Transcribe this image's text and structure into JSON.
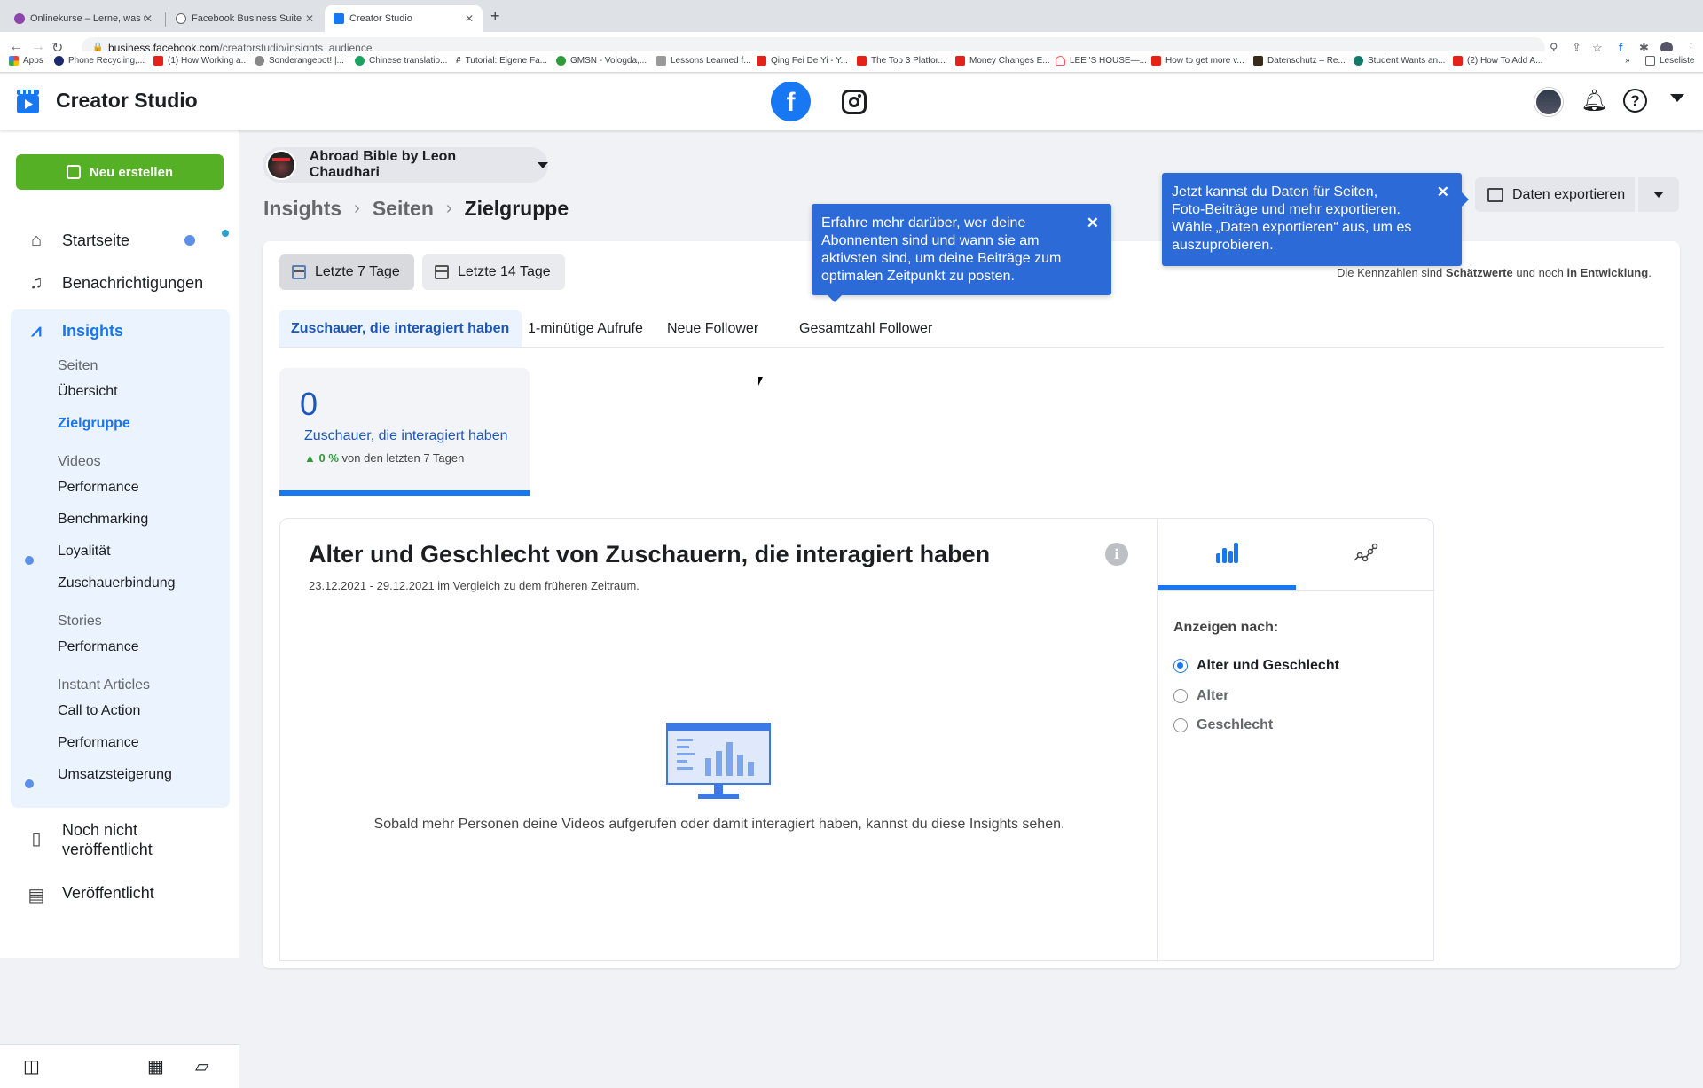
{
  "browser": {
    "tabs": [
      {
        "title": "Onlinekurse – Lerne, was und v",
        "favicon_color": "#8e44ad",
        "active": false
      },
      {
        "title": "Facebook Business Suite",
        "favicon_color": "#5f6368",
        "active": false
      },
      {
        "title": "Creator Studio",
        "favicon_color": "#1877f2",
        "active": true
      }
    ],
    "url_host": "business.facebook.com",
    "url_path": "/creatorstudio/insights_audience",
    "bookmarks": [
      {
        "label": "Apps",
        "color": "#ea4335"
      },
      {
        "label": "Phone Recycling,...",
        "color": "#1a2a6c"
      },
      {
        "label": "(1) How Working a...",
        "color": "#e62117"
      },
      {
        "label": "Sonderangebot! |...",
        "color": "#888888"
      },
      {
        "label": "Chinese translatio...",
        "color": "#1aa260"
      },
      {
        "label": "Tutorial: Eigene Fa...",
        "color": "#333333"
      },
      {
        "label": "GMSN - Vologda,...",
        "color": "#2e9b3a"
      },
      {
        "label": "Lessons Learned f...",
        "color": "#666666"
      },
      {
        "label": "Qing Fei De Yi - Y...",
        "color": "#e62117"
      },
      {
        "label": "The Top 3 Platfor...",
        "color": "#e62117"
      },
      {
        "label": "Money Changes E...",
        "color": "#e62117"
      },
      {
        "label": "LEE 'S HOUSE—...",
        "color": "#ff5a5f"
      },
      {
        "label": "How to get more v...",
        "color": "#e62117"
      },
      {
        "label": "Datenschutz – Re...",
        "color": "#3a2a1a"
      },
      {
        "label": "Student Wants an...",
        "color": "#137a6b"
      },
      {
        "label": "(2) How To Add A...",
        "color": "#e62117"
      }
    ],
    "reading_list": "Leseliste"
  },
  "app": {
    "title": "Creator Studio",
    "platforms": [
      "facebook",
      "instagram"
    ]
  },
  "sidebar": {
    "create_button": "Neu erstellen",
    "items": [
      {
        "label": "Startseite",
        "icon": "home-icon"
      },
      {
        "label": "Benachrichtigungen",
        "icon": "bell-icon"
      },
      {
        "label": "Insights",
        "icon": "insights-icon",
        "active": true
      }
    ],
    "insights_sections": [
      {
        "heading": "Seiten",
        "items": [
          "Übersicht",
          "Zielgruppe"
        ]
      },
      {
        "heading": "Videos",
        "items": [
          "Performance",
          "Benchmarking",
          "Loyalität",
          "Zuschauerbindung"
        ]
      },
      {
        "heading": "Stories",
        "items": [
          "Performance"
        ]
      },
      {
        "heading": "Instant Articles",
        "items": [
          "Call to Action",
          "Performance",
          "Umsatzsteigerung"
        ]
      }
    ],
    "active_subitem": "Zielgruppe",
    "more_items": [
      {
        "label": "Noch nicht veröffentlicht",
        "icon": "draft-icon"
      },
      {
        "label": "Veröffentlicht",
        "icon": "published-icon"
      }
    ]
  },
  "page_selector": {
    "label": "Abroad Bible by Leon Chaudhari"
  },
  "breadcrumb": [
    "Insights",
    "Seiten",
    "Zielgruppe"
  ],
  "export": {
    "label": "Daten exportieren"
  },
  "range_buttons": [
    "Letzte 7 Tage",
    "Letzte 14 Tage"
  ],
  "active_range": "Letzte 7 Tage",
  "disclaimer": {
    "prefix": "Die Kennzahlen sind ",
    "bold1": "Schätzwerte",
    "middle": " und noch ",
    "bold2": "in Entwicklung",
    "suffix": "."
  },
  "metric_tabs": [
    "Zuschauer, die interagiert haben",
    "1-minütige Aufrufe",
    "Neue Follower",
    "Gesamtzahl Follower"
  ],
  "active_metric_tab": "Zuschauer, die interagiert haben",
  "stat": {
    "value": "0",
    "label": "Zuschauer, die interagiert haben",
    "delta": "0 %",
    "delta_suffix": "von den letzten 7 Tagen",
    "delta_color": "#2e9b3a"
  },
  "chart_card": {
    "title": "Alter und Geschlecht von Zuschauern, die interagiert haben",
    "date_range": "23.12.2021 - 29.12.2021 im Vergleich zu dem früheren Zeitraum.",
    "empty_message": "Sobald mehr Personen deine Videos aufgerufen oder damit interagiert haben, kannst du diese Insights sehen.",
    "view_tabs": [
      "bar-chart",
      "line-chart"
    ],
    "show_by_label": "Anzeigen nach:",
    "show_by_options": [
      "Alter und Geschlecht",
      "Alter",
      "Geschlecht"
    ],
    "show_by_selected": "Alter und Geschlecht"
  },
  "tooltips": {
    "audience": "Erfahre mehr darüber, wer deine Abonnenten sind und wann sie am aktivsten sind, um deine Beiträge zum optimalen Zeitpunkt zu posten.",
    "export": "Jetzt kannst du Daten für Seiten, Foto-Beiträge und mehr exportieren. Wähle „Daten exportieren“ aus, um es auszuprobieren."
  },
  "colors": {
    "accent": "#1877f2",
    "create_green": "#55b025",
    "tooltip_blue": "#2c6ad8"
  }
}
